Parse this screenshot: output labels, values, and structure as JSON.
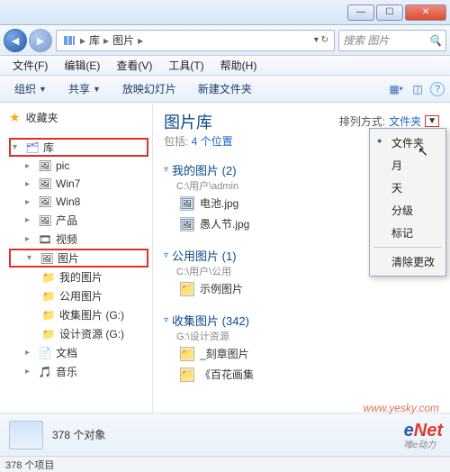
{
  "window": {
    "min_tip": "最小化",
    "max_tip": "最大化",
    "close_tip": "关闭"
  },
  "nav": {
    "root": "库",
    "current": "图片",
    "search_placeholder": "搜索 图片"
  },
  "menu": {
    "file": "文件(F)",
    "edit": "编辑(E)",
    "view": "查看(V)",
    "tools": "工具(T)",
    "help": "帮助(H)"
  },
  "toolbar": {
    "organize": "组织",
    "share": "共享",
    "slideshow": "放映幻灯片",
    "newfolder": "新建文件夹"
  },
  "sidebar": {
    "favorites": "收藏夹",
    "library": "库",
    "lib_children": [
      {
        "label": "pic"
      },
      {
        "label": "Win7"
      },
      {
        "label": "Win8"
      },
      {
        "label": "产品"
      },
      {
        "label": "视频"
      }
    ],
    "pictures": "图片",
    "pictures_children": [
      {
        "label": "我的图片"
      },
      {
        "label": "公用图片"
      },
      {
        "label": "收集图片 (G:)"
      },
      {
        "label": "设计资源 (G:)"
      }
    ],
    "documents": "文档",
    "music": "音乐"
  },
  "content": {
    "title": "图片库",
    "subtitle_prefix": "包括: ",
    "subtitle_link": "4 个位置",
    "arrange_label": "排列方式:",
    "arrange_value": "文件夹",
    "groups": [
      {
        "title": "我的图片 (2)",
        "path": "C:\\用户\\admin",
        "items": [
          {
            "label": "电池.jpg",
            "kind": "img"
          },
          {
            "label": "愚人节.jpg",
            "kind": "img"
          }
        ]
      },
      {
        "title": "公用图片 (1)",
        "path": "C:\\用户\\公用",
        "items": [
          {
            "label": "示例图片",
            "kind": "folder"
          }
        ]
      },
      {
        "title": "收集图片 (342)",
        "path": "G:\\设计资源",
        "items": [
          {
            "label": "_刻章图片",
            "kind": "folder"
          },
          {
            "label": "《百花画集",
            "kind": "folder"
          }
        ]
      }
    ]
  },
  "dropdown": {
    "items": [
      "文件夹",
      "月",
      "天",
      "分级",
      "标记"
    ],
    "clear": "清除更改"
  },
  "details": {
    "count": "378 个对象"
  },
  "status": {
    "text": "378 个项目"
  },
  "watermark": {
    "brand_e": "e",
    "brand_net": "Net",
    "brand_sub": "唯e动力",
    "yesky": "www.yesky.com"
  }
}
